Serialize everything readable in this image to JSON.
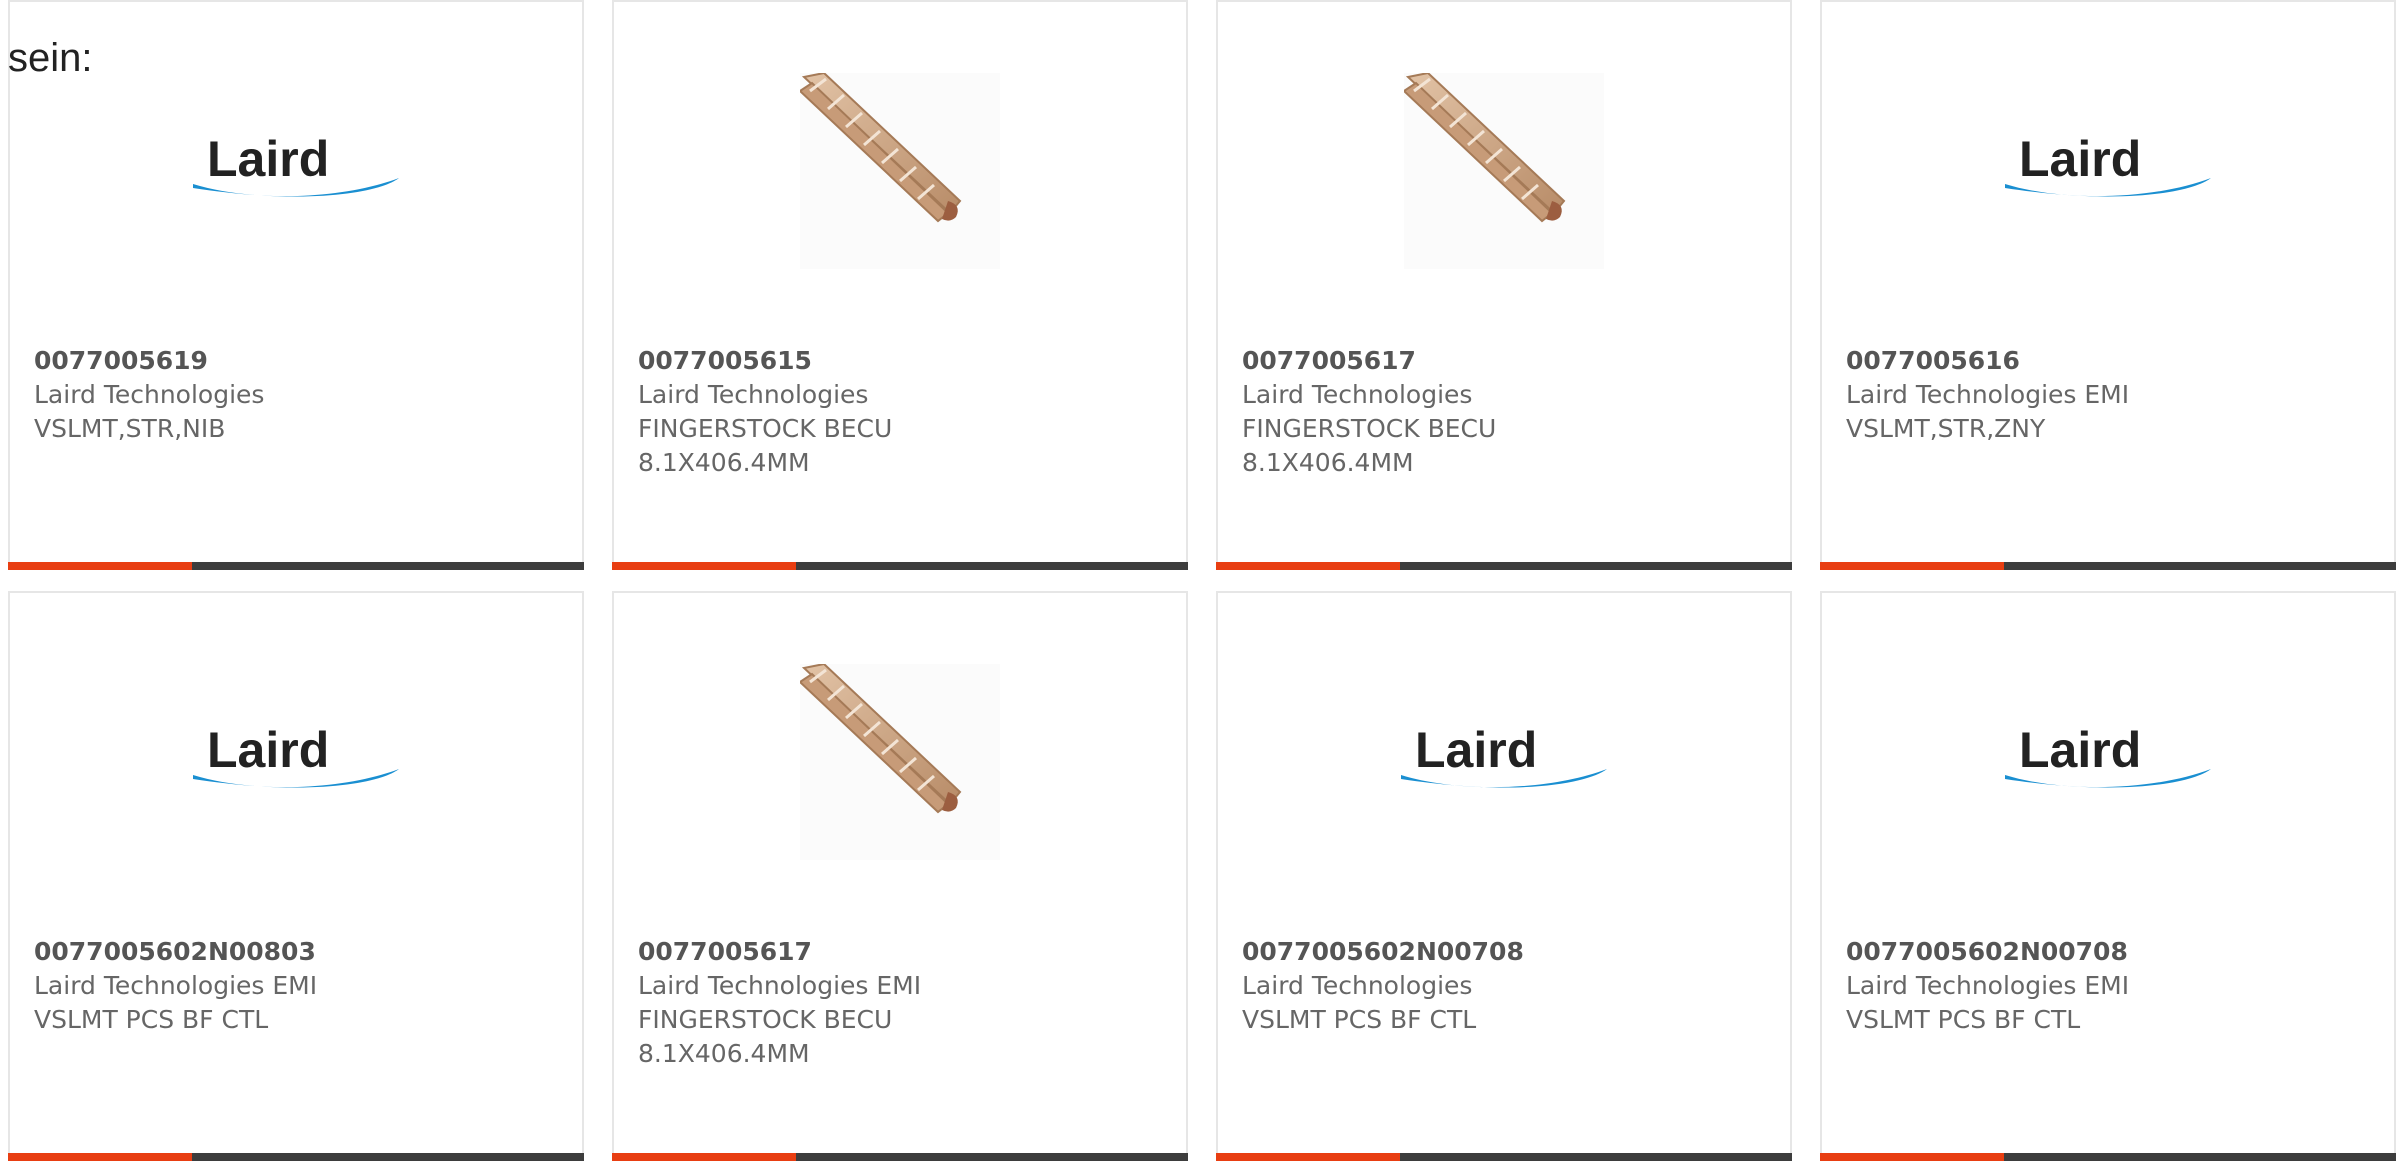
{
  "intro_text": "sein:",
  "colors": {
    "accent": "#e83e12",
    "bar": "#3d3d3d",
    "text": "#666666",
    "logo_blue": "#1a8fd1"
  },
  "logo_text": "Laird",
  "products": [
    {
      "part_number": "0077005619",
      "manufacturer": "Laird Technologies",
      "description": [
        "VSLMT,STR,NIB"
      ],
      "image": "laird-logo"
    },
    {
      "part_number": "0077005615",
      "manufacturer": "Laird Technologies",
      "description": [
        "FINGERSTOCK BECU",
        "8.1X406.4MM"
      ],
      "image": "fingerstock-photo"
    },
    {
      "part_number": "0077005617",
      "manufacturer": "Laird Technologies",
      "description": [
        "FINGERSTOCK BECU",
        "8.1X406.4MM"
      ],
      "image": "fingerstock-photo"
    },
    {
      "part_number": "0077005616",
      "manufacturer": "Laird Technologies EMI",
      "description": [
        "VSLMT,STR,ZNY"
      ],
      "image": "laird-logo"
    },
    {
      "part_number": "0077005602N00803",
      "manufacturer": "Laird Technologies EMI",
      "description": [
        "VSLMT PCS BF CTL"
      ],
      "image": "laird-logo"
    },
    {
      "part_number": "0077005617",
      "manufacturer": "Laird Technologies EMI",
      "description": [
        "FINGERSTOCK BECU",
        "8.1X406.4MM"
      ],
      "image": "fingerstock-photo"
    },
    {
      "part_number": "0077005602N00708",
      "manufacturer": "Laird Technologies",
      "description": [
        "VSLMT PCS BF CTL"
      ],
      "image": "laird-logo"
    },
    {
      "part_number": "0077005602N00708",
      "manufacturer": "Laird Technologies EMI",
      "description": [
        "VSLMT PCS BF CTL"
      ],
      "image": "laird-logo"
    }
  ]
}
